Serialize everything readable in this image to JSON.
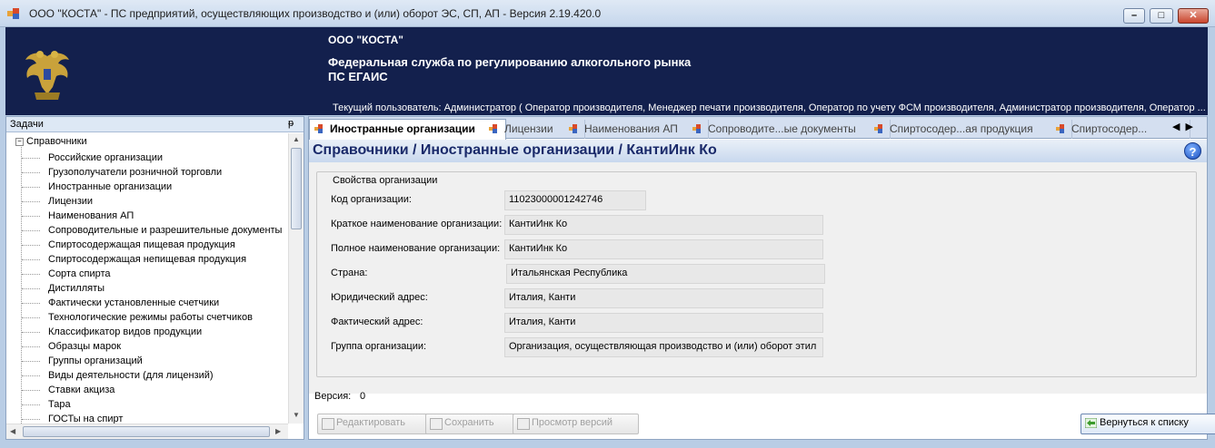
{
  "window": {
    "title": "ООО \"КОСТА\" - ПС предприятий, осуществляющих производство и (или) оборот ЭС, СП, АП - Версия 2.19.420.0",
    "min_glyph": "–",
    "max_glyph": "□",
    "close_glyph": "✕"
  },
  "header": {
    "org": "ООО \"КОСТА\"",
    "agency": "Федеральная служба по регулированию алкогольного рынка",
    "system": "ПС ЕГАИС",
    "user": "Текущий пользователь: Администратор ( Оператор производителя, Менеджер печати производителя, Оператор по учету ФСМ производителя, Администратор производителя, Оператор ..."
  },
  "tasks": {
    "title": "Задачи",
    "pin": "ᵽ",
    "root": "Справочники",
    "root_toggle": "−",
    "items": [
      "Российские организации",
      "Грузополучатели розничной торговли",
      "Иностранные организации",
      "Лицензии",
      "Наименования АП",
      "Сопроводительные и разрешительные документы",
      "Спиртосодержащая пищевая продукция",
      "Спиртосодержащая непищевая продукция",
      "Сорта спирта",
      "Дистилляты",
      "Фактически установленные счетчики",
      "Технологические режимы работы счетчиков",
      "Классификатор видов продукции",
      "Образцы марок",
      "Группы организаций",
      "Виды деятельности (для лицензий)",
      "Ставки акциза",
      "Тара",
      "ГОСТы на спирт"
    ]
  },
  "tabs": [
    {
      "label": "Иностранные организации"
    },
    {
      "label": "Лицензии"
    },
    {
      "label": "Наименования АП"
    },
    {
      "label": "Сопроводите...ые документы"
    },
    {
      "label": "Спиртосодер...ая продукция"
    },
    {
      "label": "Спиртосодер..."
    }
  ],
  "tab_arrows": "◀▶",
  "breadcrumb": "Справочники / Иностранные организации / КантиИнк Ко",
  "help": "?",
  "form": {
    "group_title": "Свойства организации",
    "fields": [
      {
        "label": "Код организации:",
        "value": "11023000001242746"
      },
      {
        "label": "Краткое наименование организации:",
        "value": "КантиИнк Ко"
      },
      {
        "label": "Полное наименование организации:",
        "value": "КантиИнк Ко"
      },
      {
        "label": "Страна:",
        "value": "Итальянская Республика"
      },
      {
        "label": "Юридический адрес:",
        "value": "Италия, Канти"
      },
      {
        "label": "Фактический адрес:",
        "value": "Италия, Канти"
      },
      {
        "label": "Группа организации:",
        "value": "Организация, осуществляющая производство и (или) оборот этил"
      }
    ]
  },
  "version": {
    "label": "Версия:",
    "value": "0"
  },
  "buttons": {
    "edit": "Редактировать",
    "save": "Сохранить",
    "history": "Просмотр версий",
    "back": "Вернуться к списку"
  },
  "colors": {
    "banner": "#13204d",
    "breadcrumb_text": "#1a2a6a",
    "panel_bg": "#b9cde5"
  }
}
